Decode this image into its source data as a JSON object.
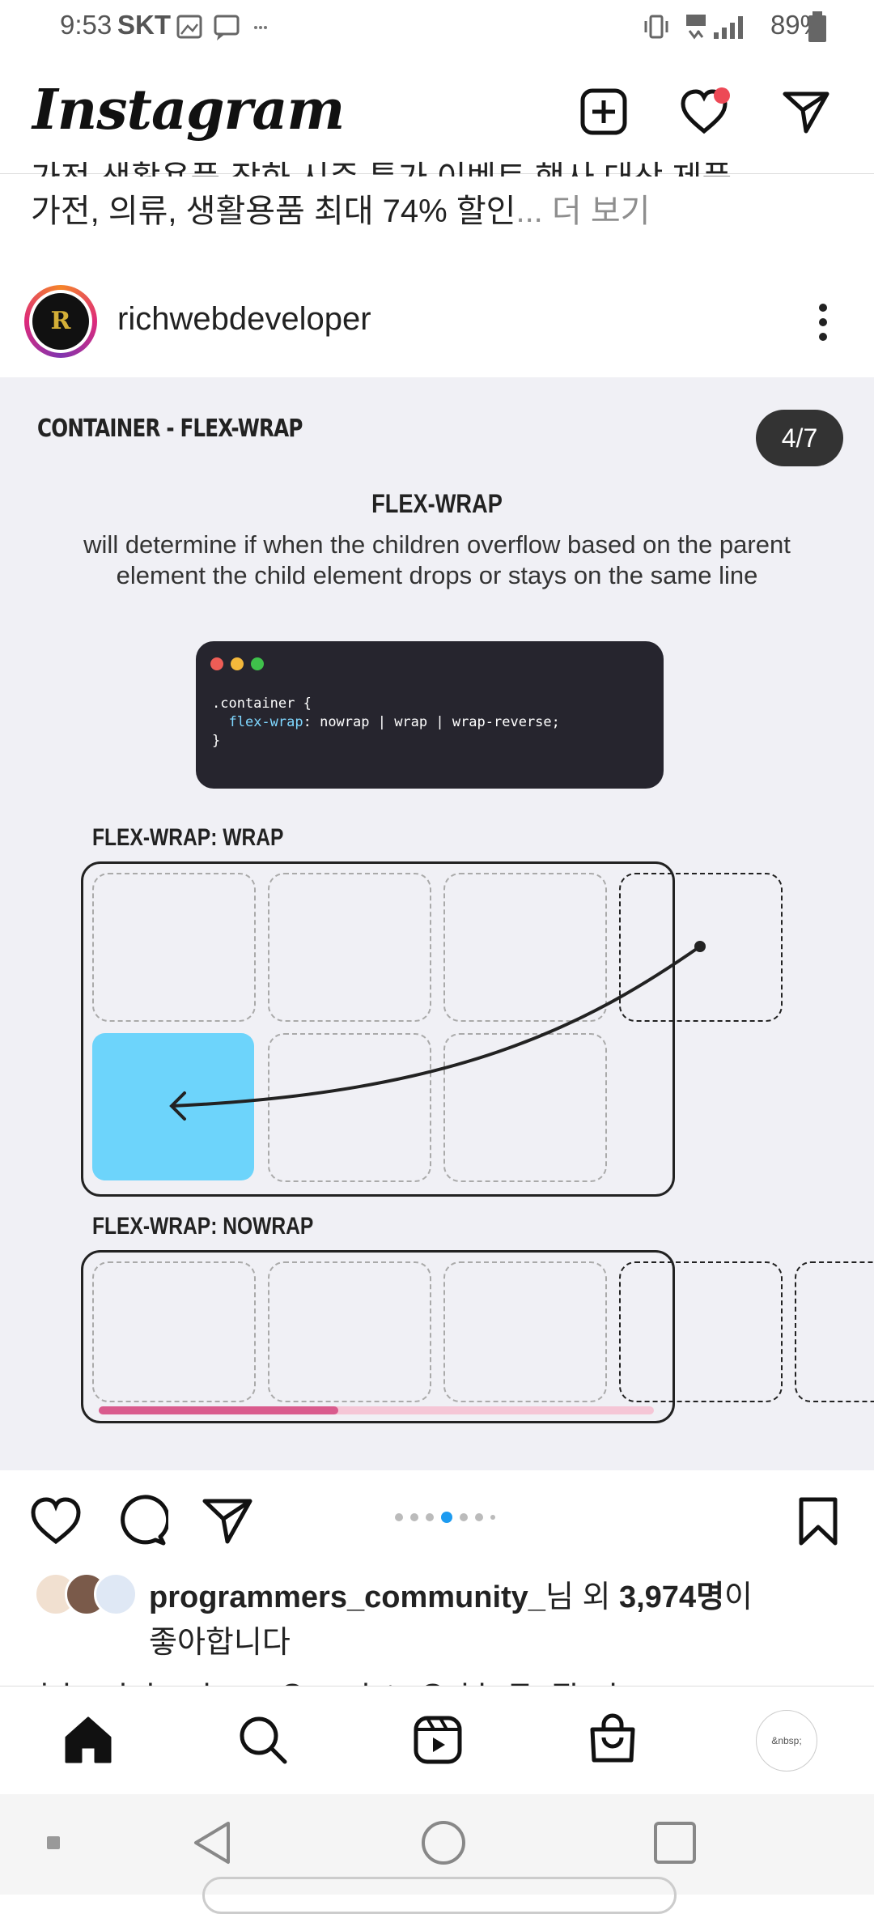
{
  "status": {
    "time": "9:53",
    "carrier": "SKT",
    "battery": "89%",
    "network": "LTE"
  },
  "header": {
    "logo": "Instagram",
    "icons": [
      "add-post-icon",
      "heart-icon",
      "send-icon"
    ],
    "notification_dot_color": "#ed4956"
  },
  "prev_caption": {
    "cut_line": "가전·생활용품·잡화 시즌 특가 이벤트 행사 대상 제품",
    "line": "가전, 의류, 생활용품 최대 74% 할인",
    "more": "... 더 보기"
  },
  "post": {
    "username": "richwebdeveloper",
    "avatar_letter": "R",
    "slide": {
      "title": "CONTAINER - FLEX-WRAP",
      "counter": "4/7",
      "heading": "FLEX-WRAP",
      "description": "will determine if when the children overflow based on the parent element the child element drops or stays on the same line",
      "code": {
        "line1": ".container {",
        "prop": "flex-wrap",
        "line2_rest": ": nowrap | wrap | wrap-reverse;",
        "line3": "}"
      },
      "wrap_label": "FLEX-WRAP: WRAP",
      "nowrap_label": "FLEX-WRAP: NOWRAP",
      "scroll_progress": 0.43,
      "accent_blue": "#6dd4fb",
      "accent_pink": "#d95b8d"
    },
    "carousel": {
      "total": 7,
      "active": 4
    },
    "likes": {
      "user": "programmers_community_",
      "mid": "님 외 ",
      "count": "3,974명",
      "end": "이",
      "line2": "좋아합니다"
    },
    "caption_cut": "richwebdeveloper Complete Guide To Flexbox"
  },
  "bottom_nav": {
    "items": [
      "home-icon",
      "search-icon",
      "reels-icon",
      "shop-icon"
    ],
    "profile_text": "&nbsp;"
  },
  "system_nav": [
    "recent-dot",
    "back-icon",
    "home-circle-icon",
    "overview-icon"
  ]
}
